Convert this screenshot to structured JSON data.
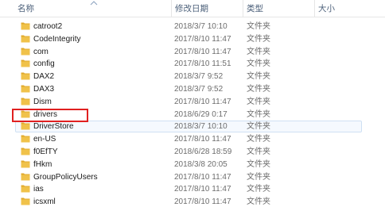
{
  "header": {
    "name": "名称",
    "date_modified": "修改日期",
    "type": "类型",
    "size": "大小"
  },
  "files": [
    {
      "name": "catroot2",
      "date": "2018/3/7 10:10",
      "type": "文件夹"
    },
    {
      "name": "CodeIntegrity",
      "date": "2017/8/10 11:47",
      "type": "文件夹"
    },
    {
      "name": "com",
      "date": "2017/8/10 11:47",
      "type": "文件夹"
    },
    {
      "name": "config",
      "date": "2017/8/10 11:51",
      "type": "文件夹"
    },
    {
      "name": "DAX2",
      "date": "2018/3/7 9:52",
      "type": "文件夹"
    },
    {
      "name": "DAX3",
      "date": "2018/3/7 9:52",
      "type": "文件夹"
    },
    {
      "name": "Dism",
      "date": "2017/8/10 11:47",
      "type": "文件夹"
    },
    {
      "name": "drivers",
      "date": "2018/6/29 0:17",
      "type": "文件夹"
    },
    {
      "name": "DriverStore",
      "date": "2018/3/7 10:10",
      "type": "文件夹"
    },
    {
      "name": "en-US",
      "date": "2017/8/10 11:47",
      "type": "文件夹"
    },
    {
      "name": "f0EfTY",
      "date": "2018/6/28 18:59",
      "type": "文件夹"
    },
    {
      "name": "fHkm",
      "date": "2018/3/8 20:05",
      "type": "文件夹"
    },
    {
      "name": "GroupPolicyUsers",
      "date": "2017/8/10 11:47",
      "type": "文件夹"
    },
    {
      "name": "ias",
      "date": "2017/8/10 11:47",
      "type": "文件夹"
    },
    {
      "name": "icsxml",
      "date": "2017/8/10 11:47",
      "type": "文件夹"
    }
  ],
  "colors": {
    "folder": "#f0c24a",
    "header_text": "#4c607a",
    "highlight": "#e02020",
    "hover_bg": "#f5f9fe"
  }
}
